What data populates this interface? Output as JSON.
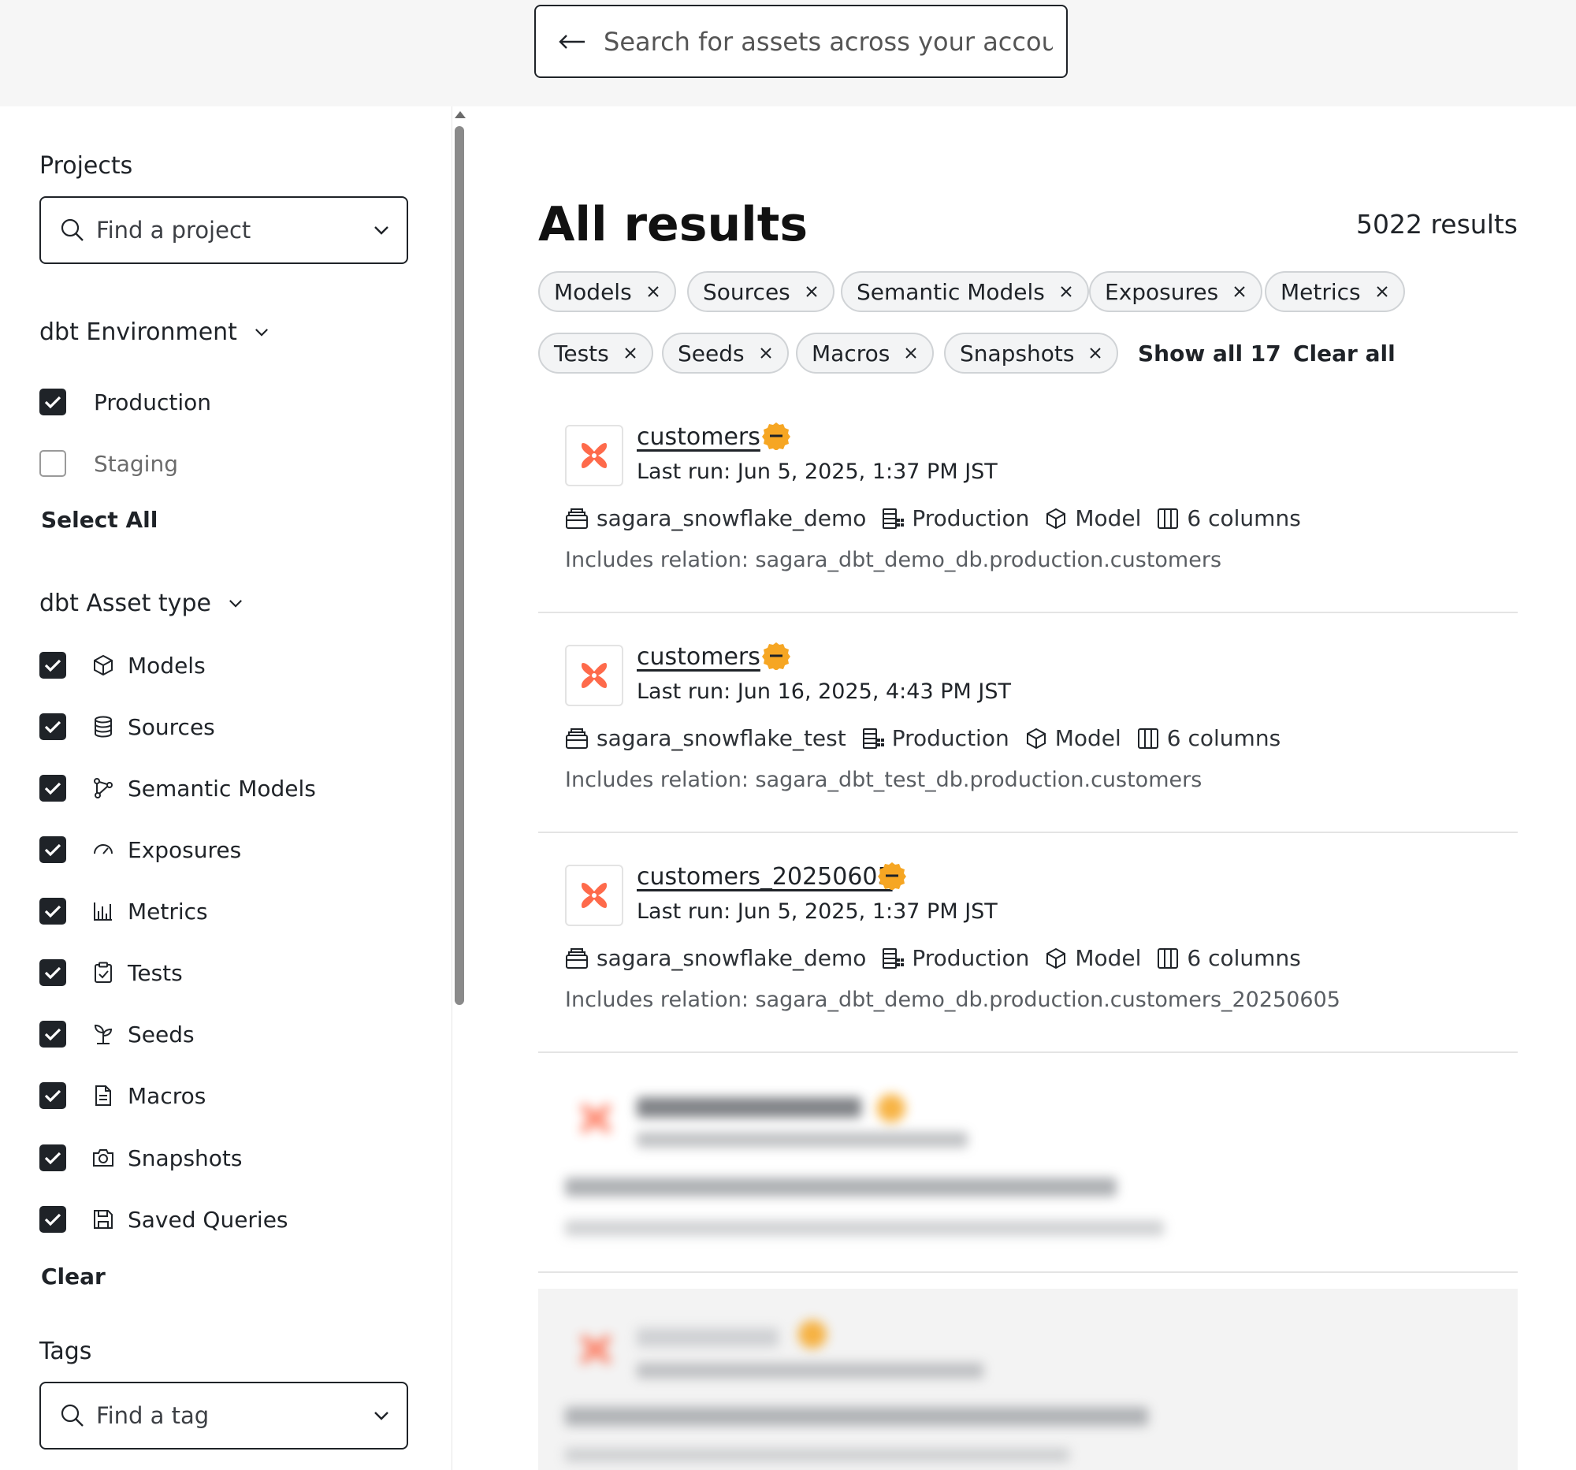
{
  "search": {
    "placeholder": "Search for assets across your account"
  },
  "sidebar": {
    "projects": {
      "title": "Projects",
      "placeholder": "Find a project"
    },
    "environment": {
      "title": "dbt Environment",
      "options": [
        {
          "label": "Production",
          "checked": true
        },
        {
          "label": "Staging",
          "checked": false
        }
      ],
      "select_all": "Select All"
    },
    "asset_type": {
      "title": "dbt Asset type",
      "options": [
        {
          "label": "Models",
          "icon": "cube-icon"
        },
        {
          "label": "Sources",
          "icon": "database-icon"
        },
        {
          "label": "Semantic Models",
          "icon": "graph-icon"
        },
        {
          "label": "Exposures",
          "icon": "gauge-icon"
        },
        {
          "label": "Metrics",
          "icon": "bar-chart-icon"
        },
        {
          "label": "Tests",
          "icon": "clipboard-check-icon"
        },
        {
          "label": "Seeds",
          "icon": "seedling-icon"
        },
        {
          "label": "Macros",
          "icon": "document-icon"
        },
        {
          "label": "Snapshots",
          "icon": "camera-icon"
        },
        {
          "label": "Saved Queries",
          "icon": "save-icon"
        }
      ],
      "clear": "Clear"
    },
    "tags": {
      "title": "Tags",
      "placeholder": "Find a tag"
    }
  },
  "main": {
    "title": "All results",
    "count": "5022 results",
    "chips": [
      "Models",
      "Sources",
      "Semantic Models",
      "Exposures",
      "Metrics",
      "Tests",
      "Seeds",
      "Macros",
      "Snapshots"
    ],
    "show_all": "Show all 17",
    "clear_all": "Clear all",
    "results": [
      {
        "name": "customers",
        "last_run": "Last run: Jun 5, 2025, 1:37 PM JST",
        "project": "sagara_snowflake_demo",
        "environment": "Production",
        "type": "Model",
        "columns": "6 columns",
        "relation": "Includes relation: sagara_dbt_demo_db.production.customers"
      },
      {
        "name": "customers",
        "last_run": "Last run: Jun 16, 2025, 4:43 PM JST",
        "project": "sagara_snowflake_test",
        "environment": "Production",
        "type": "Model",
        "columns": "6 columns",
        "relation": "Includes relation: sagara_dbt_test_db.production.customers"
      },
      {
        "name": "customers_20250605",
        "last_run": "Last run: Jun 5, 2025, 1:37 PM JST",
        "project": "sagara_snowflake_demo",
        "environment": "Production",
        "type": "Model",
        "columns": "6 columns",
        "relation": "Includes relation: sagara_dbt_demo_db.production.customers_20250605"
      }
    ]
  },
  "colors": {
    "dbt_orange": "#fe6a4b",
    "badge": "#f6a623",
    "text": "#1f2328"
  }
}
